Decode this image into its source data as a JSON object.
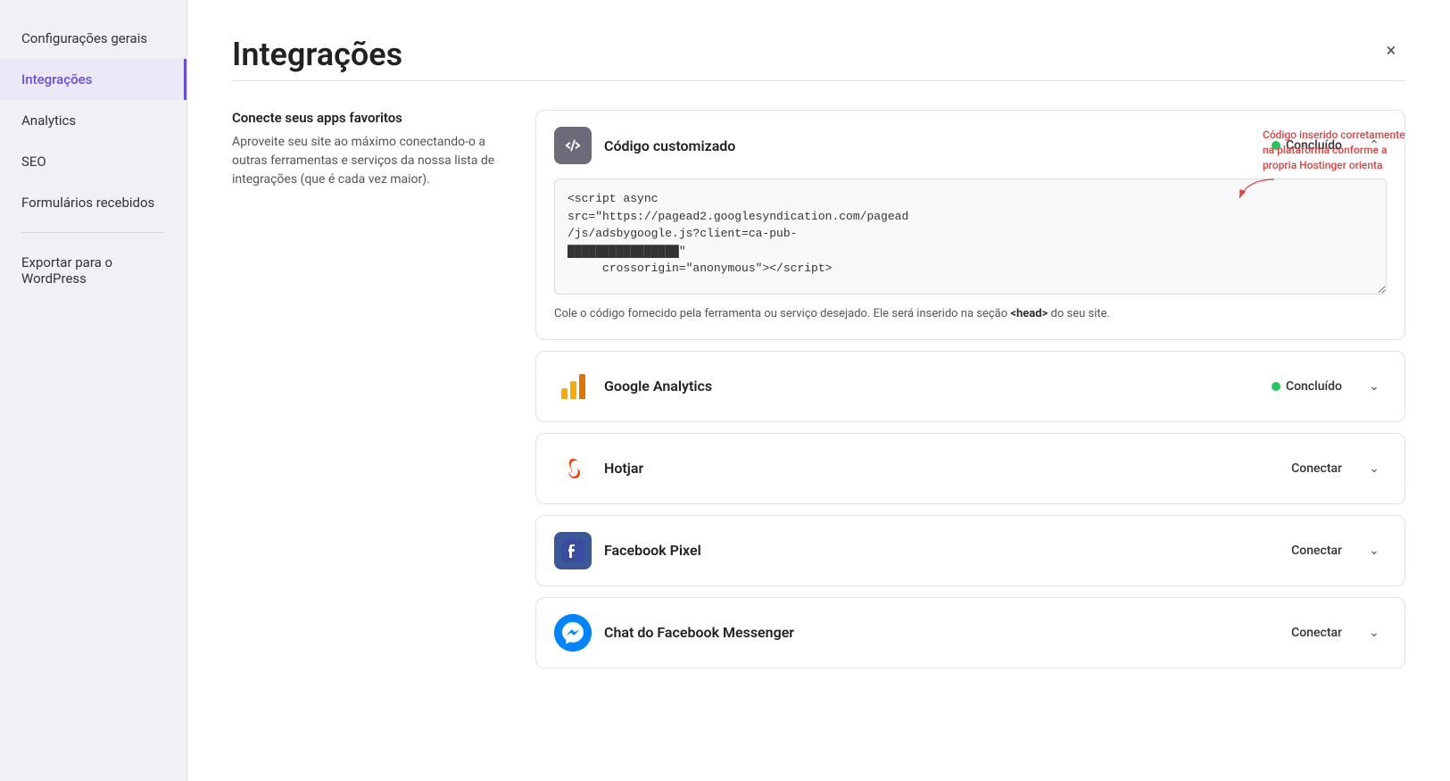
{
  "sidebar": {
    "items": [
      {
        "id": "configuracoes-gerais",
        "label": "Configurações gerais",
        "active": false
      },
      {
        "id": "integracoes",
        "label": "Integrações",
        "active": true
      },
      {
        "id": "analytics",
        "label": "Analytics",
        "active": false
      },
      {
        "id": "seo",
        "label": "SEO",
        "active": false
      },
      {
        "id": "formularios",
        "label": "Formulários recebidos",
        "active": false
      },
      {
        "id": "exportar-wordpress",
        "label": "Exportar para o WordPress",
        "active": false
      }
    ]
  },
  "header": {
    "title": "Integrações",
    "close_label": "×"
  },
  "left_section": {
    "title": "Conecte seus apps favoritos",
    "description": "Aproveite seu site ao máximo conectando-o a outras ferramentas e serviços da nossa lista de integrações (que é cada vez maior)."
  },
  "annotation": {
    "text": "Código inserido corretamente na plataforma conforme a propria Hostinger orienta"
  },
  "integrations": [
    {
      "id": "codigo-customizado",
      "title": "Código customizado",
      "icon_type": "code",
      "status": "Concluído",
      "status_done": true,
      "expanded": true,
      "code": "<script async\nsrc=\"https://pagead2.googlesyndication.com/pagead\n/js/adsbygoogle.js?client=ca-pub-\n[REDACTED]\n     crossorigin=\"anonymous\"></script>",
      "code_desc_before": "Cole o código fornecido pela ferramenta ou serviço desejado. Ele será inserido na seção ",
      "code_desc_tag": "<head>",
      "code_desc_after": " do seu site."
    },
    {
      "id": "google-analytics",
      "title": "Google Analytics",
      "icon_type": "ga",
      "status": "Concluído",
      "status_done": true,
      "expanded": false
    },
    {
      "id": "hotjar",
      "title": "Hotjar",
      "icon_type": "hotjar",
      "status": "Conectar",
      "status_done": false,
      "expanded": false
    },
    {
      "id": "facebook-pixel",
      "title": "Facebook Pixel",
      "icon_type": "fb-pixel",
      "status": "Conectar",
      "status_done": false,
      "expanded": false
    },
    {
      "id": "facebook-messenger",
      "title": "Chat do Facebook Messenger",
      "icon_type": "fb-messenger",
      "status": "Conectar",
      "status_done": false,
      "expanded": false
    }
  ]
}
